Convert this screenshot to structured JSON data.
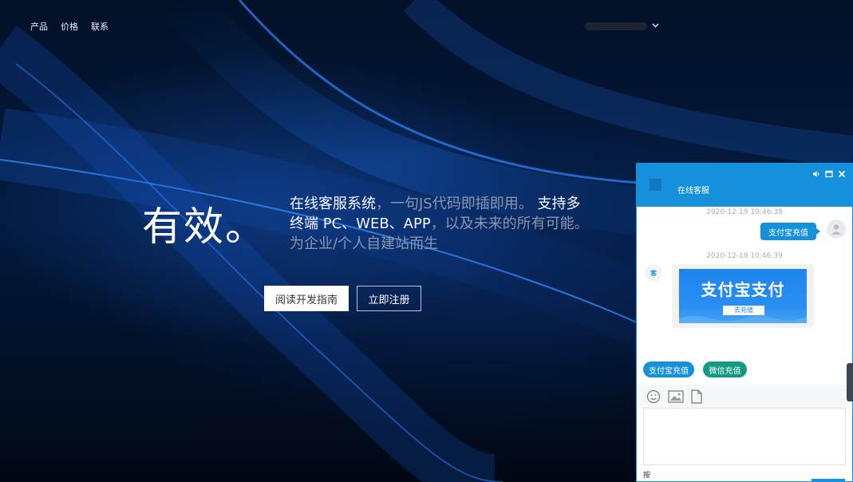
{
  "nav": {
    "items": [
      "产品",
      "价格",
      "联系"
    ]
  },
  "account": {
    "chevron": "chevron-down-icon"
  },
  "hero": {
    "title": "有效。",
    "desc_highlight_1": "在线客服系统",
    "desc_text_1": "，一句JS代码即插即用。",
    "desc_highlight_2": "支持多终端 PC、WEB、APP",
    "desc_text_2": "，以及未来的所有可能。为企业/个人自建站而生",
    "btn_primary": "阅读开发指南",
    "btn_secondary": "立即注册"
  },
  "chat": {
    "title": "在线客服",
    "controls": [
      "volume-icon",
      "minimize-icon",
      "close-icon"
    ],
    "messages": [
      {
        "time": "2020-12-19 10:46:38",
        "text": "支付宝充值"
      },
      {
        "time": "2020-12-19 10:46:39"
      }
    ],
    "agent_avatar_text": "客",
    "banner": {
      "title": "支付宝支付",
      "button": "去充值"
    },
    "quick_replies": [
      "支付宝充值",
      "微信充值"
    ],
    "toolbar": [
      "emoji-icon",
      "image-icon",
      "file-icon"
    ],
    "send_hint": "按"
  },
  "colors": {
    "accent": "#1591dc",
    "wechat": "#119b82",
    "background": "#031128"
  }
}
